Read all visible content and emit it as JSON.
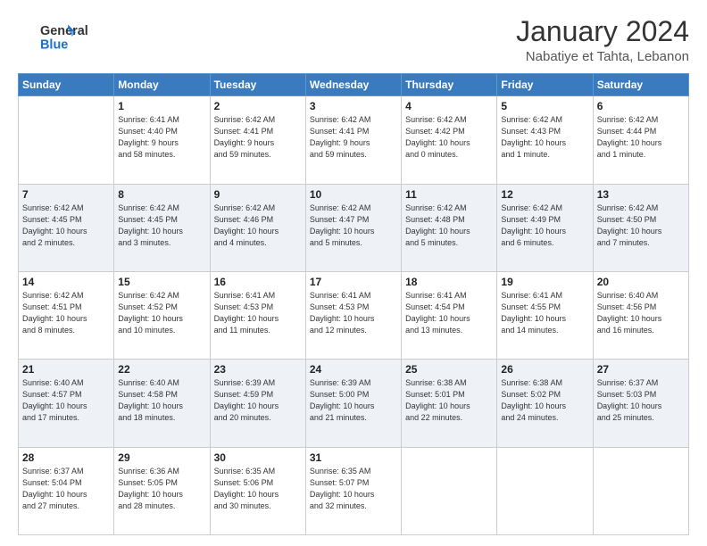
{
  "header": {
    "logo_line1": "General",
    "logo_line2": "Blue",
    "month_title": "January 2024",
    "location": "Nabatiye et Tahta, Lebanon"
  },
  "days_of_week": [
    "Sunday",
    "Monday",
    "Tuesday",
    "Wednesday",
    "Thursday",
    "Friday",
    "Saturday"
  ],
  "weeks": [
    [
      {
        "num": "",
        "info": ""
      },
      {
        "num": "1",
        "info": "Sunrise: 6:41 AM\nSunset: 4:40 PM\nDaylight: 9 hours\nand 58 minutes."
      },
      {
        "num": "2",
        "info": "Sunrise: 6:42 AM\nSunset: 4:41 PM\nDaylight: 9 hours\nand 59 minutes."
      },
      {
        "num": "3",
        "info": "Sunrise: 6:42 AM\nSunset: 4:41 PM\nDaylight: 9 hours\nand 59 minutes."
      },
      {
        "num": "4",
        "info": "Sunrise: 6:42 AM\nSunset: 4:42 PM\nDaylight: 10 hours\nand 0 minutes."
      },
      {
        "num": "5",
        "info": "Sunrise: 6:42 AM\nSunset: 4:43 PM\nDaylight: 10 hours\nand 1 minute."
      },
      {
        "num": "6",
        "info": "Sunrise: 6:42 AM\nSunset: 4:44 PM\nDaylight: 10 hours\nand 1 minute."
      }
    ],
    [
      {
        "num": "7",
        "info": "Sunrise: 6:42 AM\nSunset: 4:45 PM\nDaylight: 10 hours\nand 2 minutes."
      },
      {
        "num": "8",
        "info": "Sunrise: 6:42 AM\nSunset: 4:45 PM\nDaylight: 10 hours\nand 3 minutes."
      },
      {
        "num": "9",
        "info": "Sunrise: 6:42 AM\nSunset: 4:46 PM\nDaylight: 10 hours\nand 4 minutes."
      },
      {
        "num": "10",
        "info": "Sunrise: 6:42 AM\nSunset: 4:47 PM\nDaylight: 10 hours\nand 5 minutes."
      },
      {
        "num": "11",
        "info": "Sunrise: 6:42 AM\nSunset: 4:48 PM\nDaylight: 10 hours\nand 5 minutes."
      },
      {
        "num": "12",
        "info": "Sunrise: 6:42 AM\nSunset: 4:49 PM\nDaylight: 10 hours\nand 6 minutes."
      },
      {
        "num": "13",
        "info": "Sunrise: 6:42 AM\nSunset: 4:50 PM\nDaylight: 10 hours\nand 7 minutes."
      }
    ],
    [
      {
        "num": "14",
        "info": "Sunrise: 6:42 AM\nSunset: 4:51 PM\nDaylight: 10 hours\nand 8 minutes."
      },
      {
        "num": "15",
        "info": "Sunrise: 6:42 AM\nSunset: 4:52 PM\nDaylight: 10 hours\nand 10 minutes."
      },
      {
        "num": "16",
        "info": "Sunrise: 6:41 AM\nSunset: 4:53 PM\nDaylight: 10 hours\nand 11 minutes."
      },
      {
        "num": "17",
        "info": "Sunrise: 6:41 AM\nSunset: 4:53 PM\nDaylight: 10 hours\nand 12 minutes."
      },
      {
        "num": "18",
        "info": "Sunrise: 6:41 AM\nSunset: 4:54 PM\nDaylight: 10 hours\nand 13 minutes."
      },
      {
        "num": "19",
        "info": "Sunrise: 6:41 AM\nSunset: 4:55 PM\nDaylight: 10 hours\nand 14 minutes."
      },
      {
        "num": "20",
        "info": "Sunrise: 6:40 AM\nSunset: 4:56 PM\nDaylight: 10 hours\nand 16 minutes."
      }
    ],
    [
      {
        "num": "21",
        "info": "Sunrise: 6:40 AM\nSunset: 4:57 PM\nDaylight: 10 hours\nand 17 minutes."
      },
      {
        "num": "22",
        "info": "Sunrise: 6:40 AM\nSunset: 4:58 PM\nDaylight: 10 hours\nand 18 minutes."
      },
      {
        "num": "23",
        "info": "Sunrise: 6:39 AM\nSunset: 4:59 PM\nDaylight: 10 hours\nand 20 minutes."
      },
      {
        "num": "24",
        "info": "Sunrise: 6:39 AM\nSunset: 5:00 PM\nDaylight: 10 hours\nand 21 minutes."
      },
      {
        "num": "25",
        "info": "Sunrise: 6:38 AM\nSunset: 5:01 PM\nDaylight: 10 hours\nand 22 minutes."
      },
      {
        "num": "26",
        "info": "Sunrise: 6:38 AM\nSunset: 5:02 PM\nDaylight: 10 hours\nand 24 minutes."
      },
      {
        "num": "27",
        "info": "Sunrise: 6:37 AM\nSunset: 5:03 PM\nDaylight: 10 hours\nand 25 minutes."
      }
    ],
    [
      {
        "num": "28",
        "info": "Sunrise: 6:37 AM\nSunset: 5:04 PM\nDaylight: 10 hours\nand 27 minutes."
      },
      {
        "num": "29",
        "info": "Sunrise: 6:36 AM\nSunset: 5:05 PM\nDaylight: 10 hours\nand 28 minutes."
      },
      {
        "num": "30",
        "info": "Sunrise: 6:35 AM\nSunset: 5:06 PM\nDaylight: 10 hours\nand 30 minutes."
      },
      {
        "num": "31",
        "info": "Sunrise: 6:35 AM\nSunset: 5:07 PM\nDaylight: 10 hours\nand 32 minutes."
      },
      {
        "num": "",
        "info": ""
      },
      {
        "num": "",
        "info": ""
      },
      {
        "num": "",
        "info": ""
      }
    ]
  ]
}
